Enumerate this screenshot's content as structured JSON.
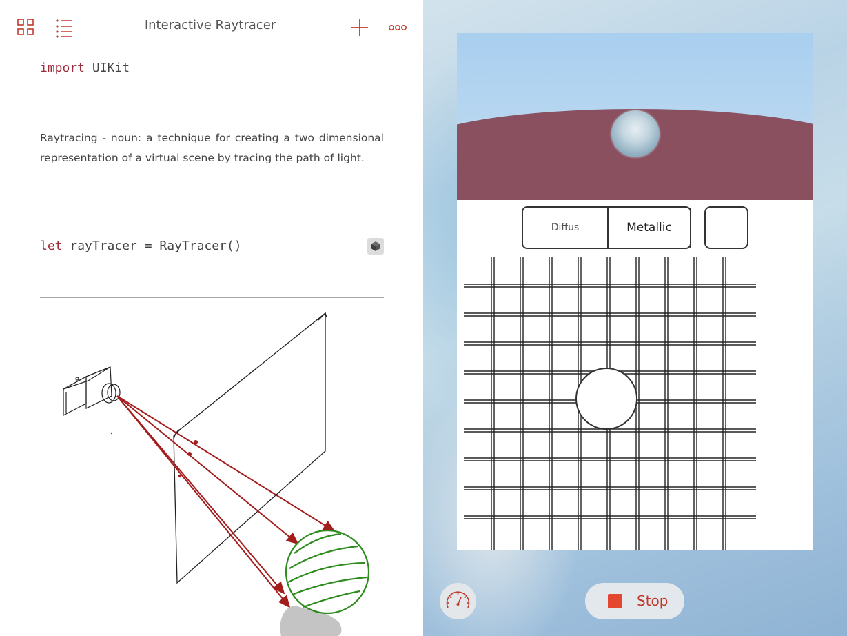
{
  "app": {
    "title": "Interactive Raytracer",
    "accent_color": "#c0392b"
  },
  "nav": {
    "left_icons": [
      "grid-icon",
      "list-icon"
    ],
    "right_icons": [
      "plus-icon",
      "more-icon"
    ]
  },
  "editor": {
    "import_line": {
      "keyword": "import",
      "module": " UIKit"
    },
    "prose": "Raytracing - noun: a technique for creating a two dimensional representation of a virtual scene by tracing the path of light.",
    "code_line": {
      "keyword": "let",
      "rest": " rayTracer = RayTracer()"
    },
    "run_icon": "cube-icon"
  },
  "illustration": {
    "icons": [
      "camera-icon",
      "image-plane",
      "sphere-icon",
      "light-rays"
    ],
    "ray_color": "#a31d1d",
    "sphere_color": "#2e8b1e"
  },
  "live_view": {
    "scene": {
      "sky_color": "#b3d4f0",
      "ground_color": "#8a5060",
      "sphere_color": "#b8ccd8"
    },
    "material_options": [
      "Diffus",
      "Metallic"
    ],
    "selected_material": "Metallic",
    "color_swatch": "#ffffff"
  },
  "bottom_bar": {
    "gauge_icon": "gauge-icon",
    "stop_label": "Stop",
    "stop_icon": "stop-square-icon"
  }
}
